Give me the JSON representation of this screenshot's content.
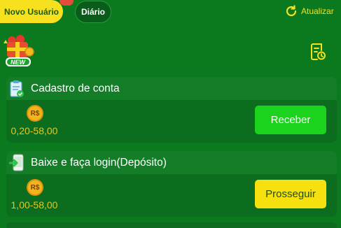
{
  "tabs": {
    "new_user": "Novo Usuário",
    "daily": "Diário"
  },
  "header": {
    "refresh_label": "Atualizar"
  },
  "badge": {
    "new_label": "NEW"
  },
  "tasks": [
    {
      "title": "Cadastro de conta",
      "currency": "R$",
      "range": "0,20-58,00",
      "button": "Receber"
    },
    {
      "title": "Baixe e faça login(Depósito)",
      "currency": "R$",
      "range": "1,00-58,00",
      "button": "Prosseguir"
    }
  ],
  "colors": {
    "background": "#0b7a1e",
    "accent_yellow": "#f7e01e",
    "receive_green": "#1bd31c",
    "coin_gold": "#f2b51c"
  },
  "icons": {
    "refresh": "refresh-icon",
    "history": "history-icon",
    "gift": "gift-icon",
    "clipboard": "clipboard-check-icon",
    "download": "phone-download-icon",
    "coin": "coin-icon"
  }
}
